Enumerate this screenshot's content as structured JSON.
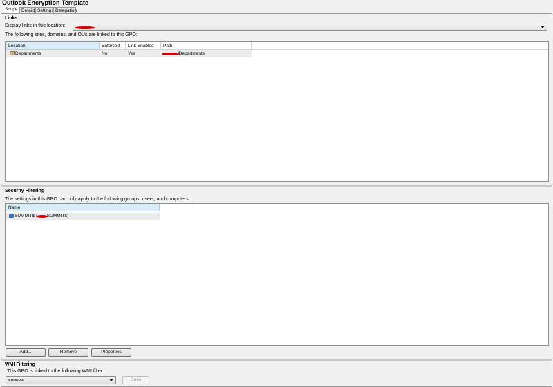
{
  "title": "Outlook Encryption Template",
  "tabs": [
    {
      "label": "Scope"
    },
    {
      "label": "Details"
    },
    {
      "label": "Settings"
    },
    {
      "label": "Delegation"
    }
  ],
  "links": {
    "heading": "Links",
    "display_label": "Display links in this location:",
    "list_caption": "The following sites, domains, and OUs are linked to this GPO:",
    "columns": [
      "Location",
      "Enforced",
      "Link Enabled",
      "Path"
    ],
    "rows": [
      {
        "location": "Departments",
        "enforced": "No",
        "link_enabled": "Yes",
        "path": "/Departments"
      }
    ]
  },
  "security": {
    "heading": "Security Filtering",
    "caption": "The settings in this GPO can only apply to the following groups, users, and computers:",
    "columns": [
      "Name"
    ],
    "rows": [
      {
        "name_prefix": "SUMMIT$ (",
        "name_suffix": "\\SUMMIT$)"
      }
    ],
    "buttons": {
      "add": "Add...",
      "remove": "Remove",
      "properties": "Properties"
    }
  },
  "wmi": {
    "heading": "WMI Filtering",
    "caption": "This GPO is linked to the following WMI filter:",
    "selected": "<none>",
    "open": "Open"
  },
  "colors": {
    "header_selected": "#d9ecfa",
    "redaction": "#d40000"
  }
}
